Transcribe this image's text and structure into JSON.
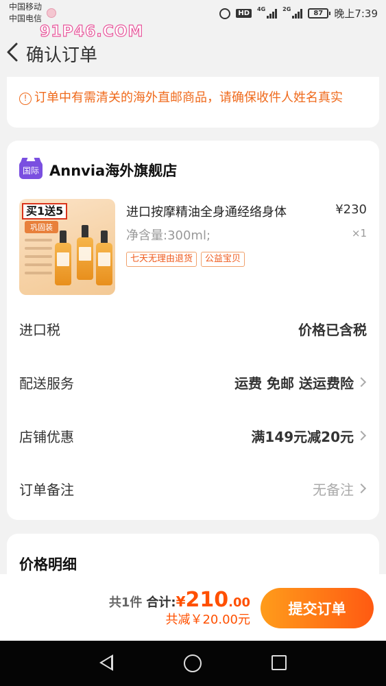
{
  "status_bar": {
    "carrier1": "中国移动",
    "carrier2": "中国电信",
    "hd": "HD",
    "net1": "4G",
    "net2": "2G",
    "battery": "87",
    "time": "晚上7:39"
  },
  "watermark": "91P46.COM",
  "nav": {
    "title": "确认订单"
  },
  "notice": {
    "icon": "!",
    "text": "订单中有需清关的海外直邮商品，请确保收件人姓名真实"
  },
  "shop": {
    "badge": "国际",
    "name": "Annvia海外旗舰店"
  },
  "product": {
    "image_promo": "买1送5",
    "image_sub": "巩固装",
    "title": "进口按摩精油全身通经络身体",
    "price": "¥230",
    "spec": "净含量:300ml;",
    "quantity": "×1",
    "tags": [
      "七天无理由退货",
      "公益宝贝"
    ]
  },
  "rows": {
    "tax_label": "进口税",
    "tax_value": "价格已含税",
    "delivery_label": "配送服务",
    "delivery_value": "运费 免邮 送运费险",
    "coupon_label": "店铺优惠",
    "coupon_value": "满149元减20元",
    "remark_label": "订单备注",
    "remark_value": "无备注"
  },
  "price_detail": {
    "title": "价格明细"
  },
  "footer": {
    "count": "共1件",
    "total_label": "合计:",
    "currency": "¥",
    "amount_int": "210",
    "amount_dec": ".00",
    "discount": "共减￥20.00元",
    "submit": "提交订单"
  },
  "colors": {
    "accent": "#ff5000",
    "notice": "#ef6a1c",
    "badge": "#7a4fe0"
  }
}
